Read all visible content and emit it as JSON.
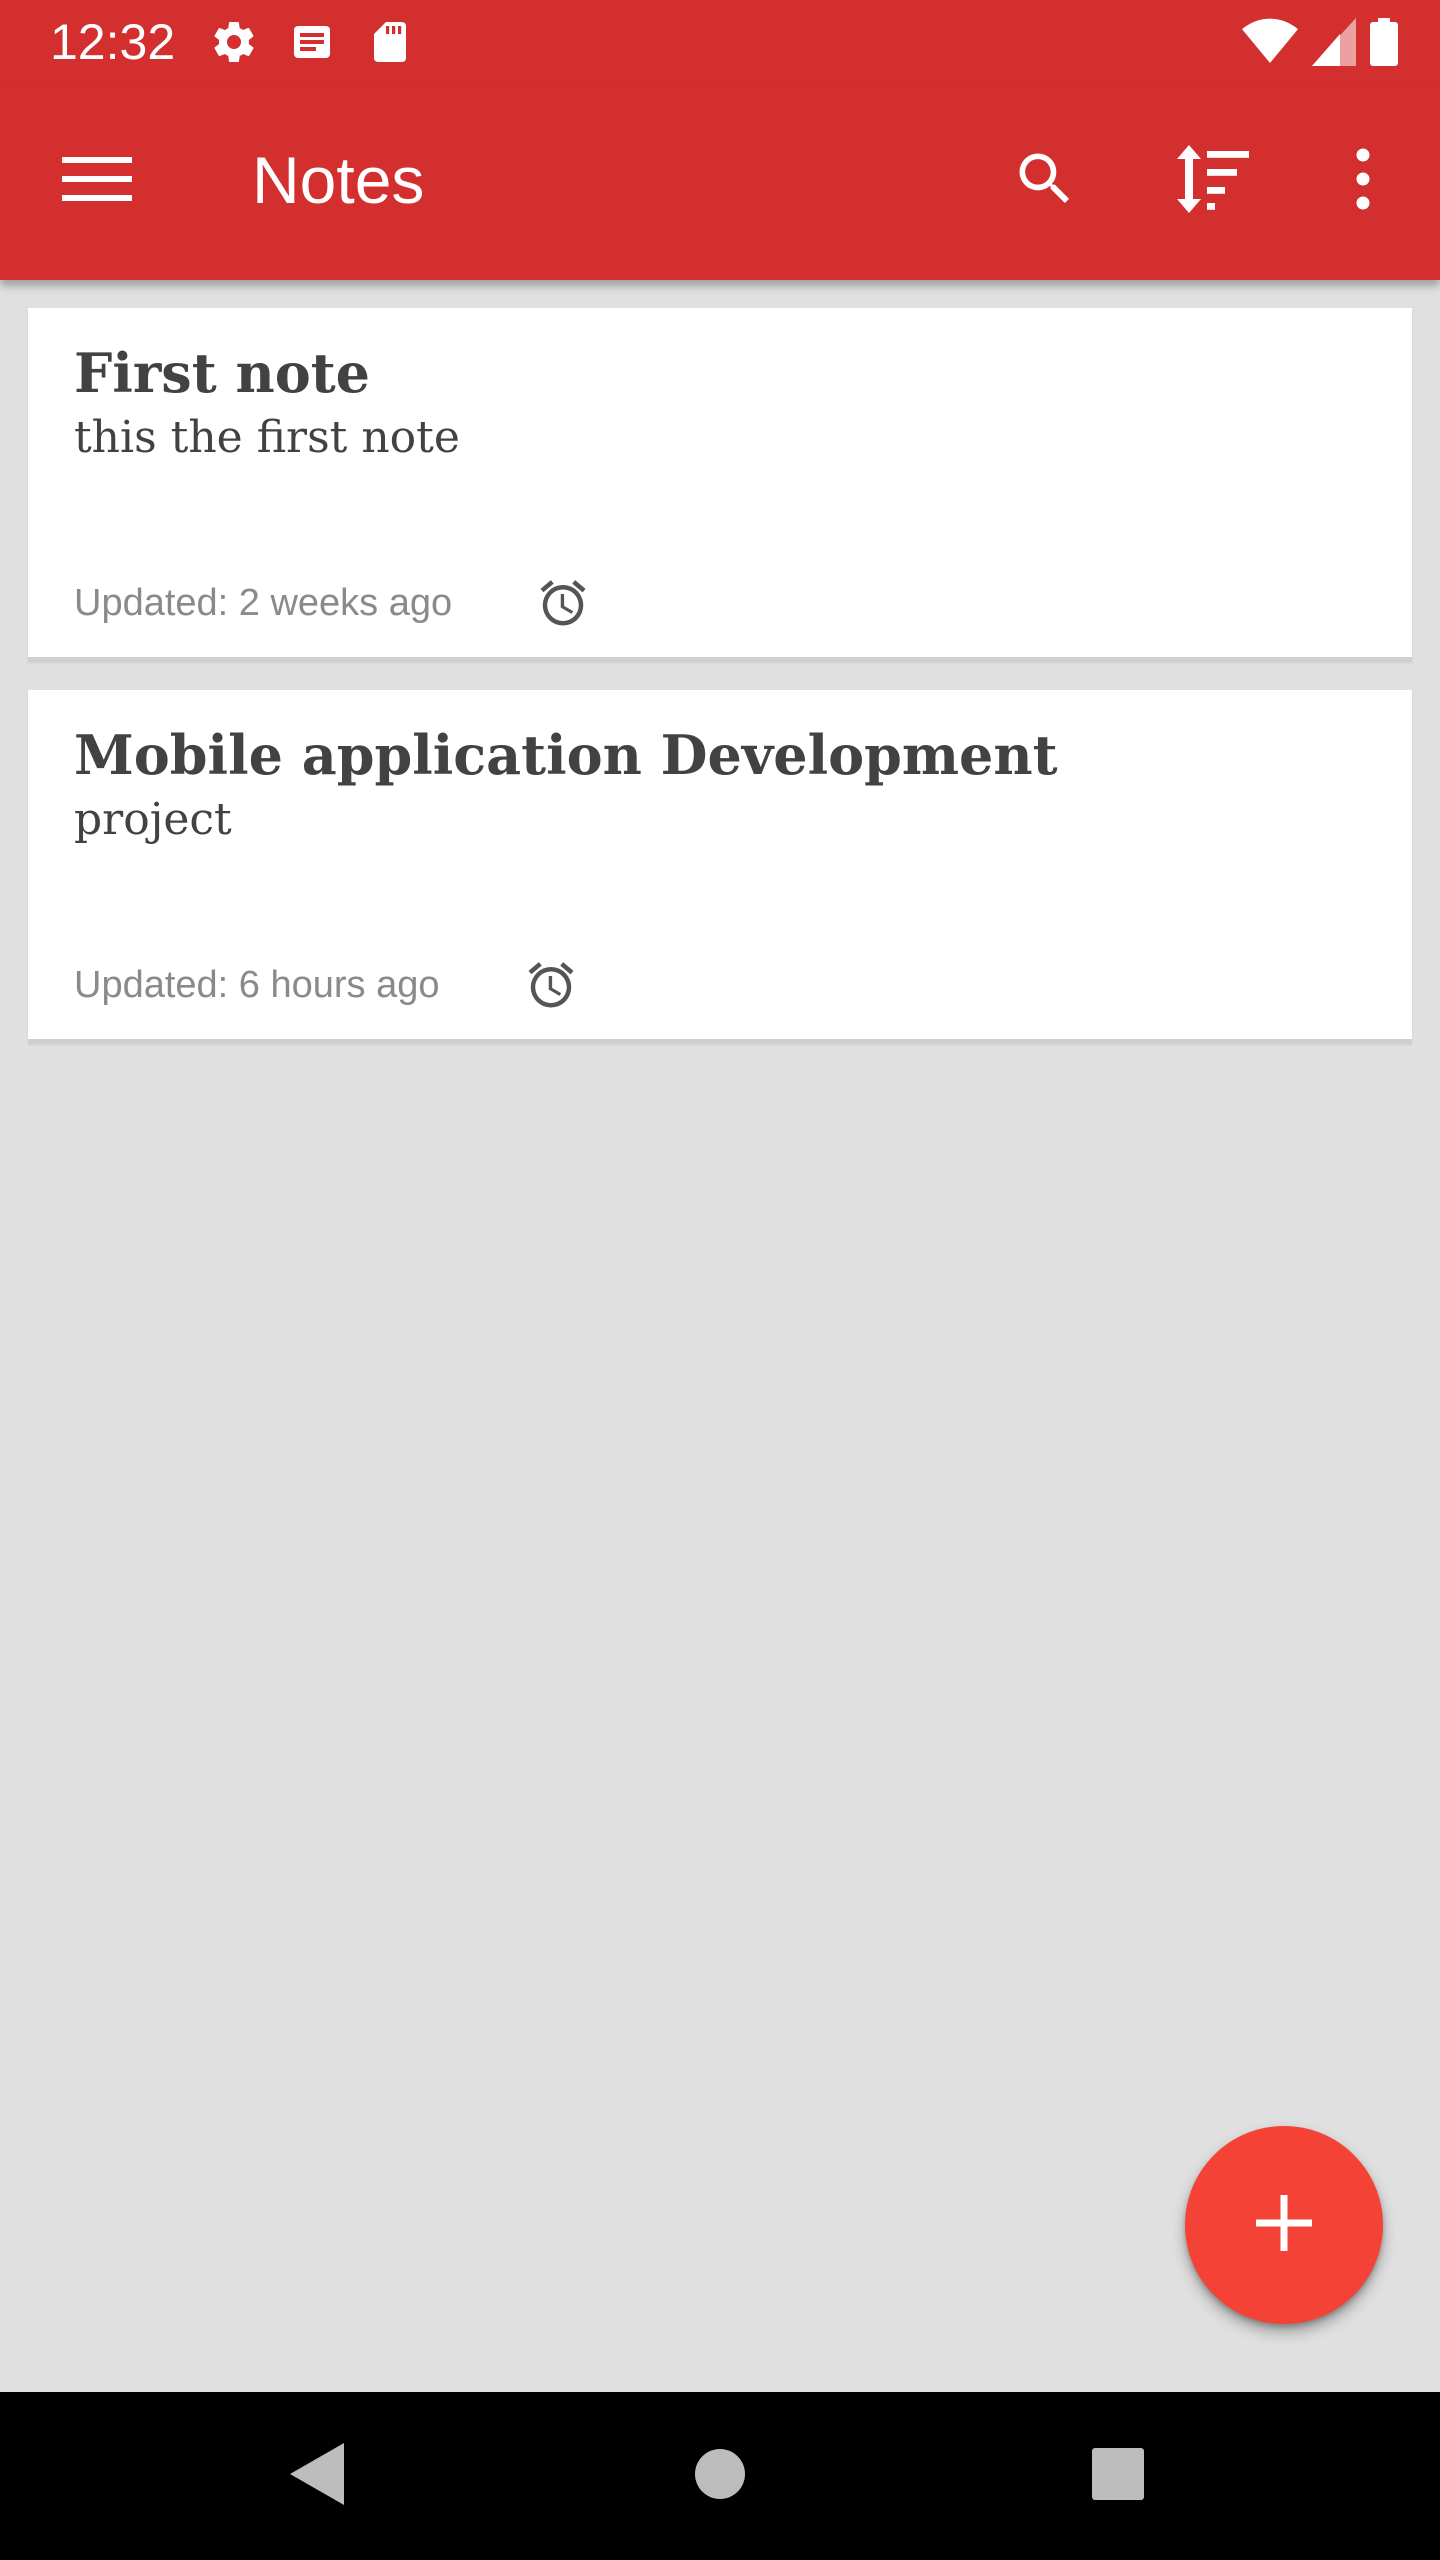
{
  "status_bar": {
    "time": "12:32",
    "left_icons": [
      "settings-icon",
      "notification-news-icon",
      "sd-card-icon"
    ],
    "right_icons": [
      "wifi-icon",
      "cell-signal-icon",
      "battery-icon"
    ]
  },
  "app_bar": {
    "title": "Notes",
    "actions": [
      "menu-icon",
      "search-icon",
      "sort-icon",
      "more-vert-icon"
    ]
  },
  "notes": [
    {
      "title": "First note",
      "body": "this the first note",
      "updated": "Updated: 2 weeks ago",
      "icon": "alarm-icon"
    },
    {
      "title": "Mobile application Development",
      "body": "project",
      "updated": "Updated: 6 hours ago",
      "icon": "alarm-icon"
    }
  ],
  "fab": {
    "icon": "plus-icon"
  },
  "nav_bar": {
    "buttons": [
      "back-icon",
      "home-icon",
      "recents-icon"
    ]
  },
  "colors": {
    "app_bar": "#d32f2f",
    "fab": "#f44336",
    "background": "#e0e0e0",
    "card": "#ffffff",
    "text_dark": "#424242",
    "text_muted": "#8a8a8a"
  }
}
